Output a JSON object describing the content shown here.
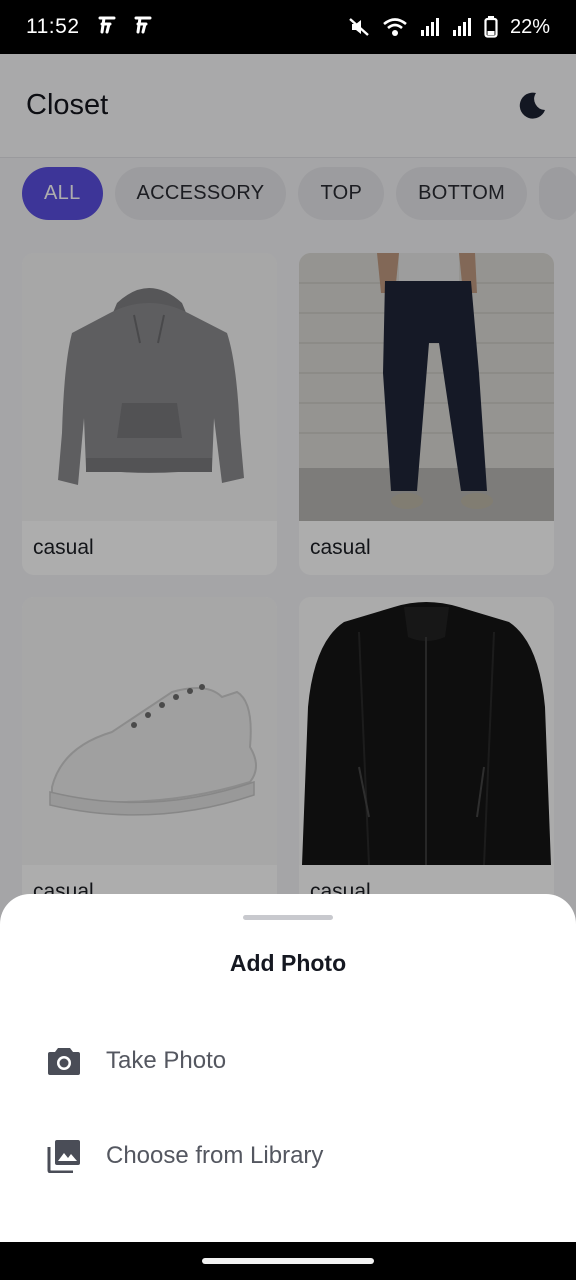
{
  "status_bar": {
    "time": "11:52",
    "battery": "22%",
    "icons": [
      "notification-f-icon",
      "notification-f-icon",
      "mute-icon",
      "wifi-icon",
      "signal-icon",
      "signal-icon",
      "battery-icon"
    ]
  },
  "app_bar": {
    "title": "Closet",
    "theme_icon": "moon-icon"
  },
  "filters": {
    "chips": [
      {
        "label": "ALL",
        "active": true
      },
      {
        "label": "ACCESSORY",
        "active": false
      },
      {
        "label": "TOP",
        "active": false
      },
      {
        "label": "BOTTOM",
        "active": false
      }
    ]
  },
  "items": [
    {
      "label": "casual",
      "image": "grey hoodie"
    },
    {
      "label": "casual",
      "image": "dark denim jeans"
    },
    {
      "label": "casual",
      "image": "white sneaker"
    },
    {
      "label": "casual",
      "image": "black leather jacket"
    }
  ],
  "sheet": {
    "title": "Add Photo",
    "options": [
      {
        "label": "Take Photo",
        "icon": "camera-icon"
      },
      {
        "label": "Choose from Library",
        "icon": "photo-library-icon"
      }
    ]
  },
  "colors": {
    "accent": "#5b4fe0",
    "icon": "#4a4d57"
  }
}
